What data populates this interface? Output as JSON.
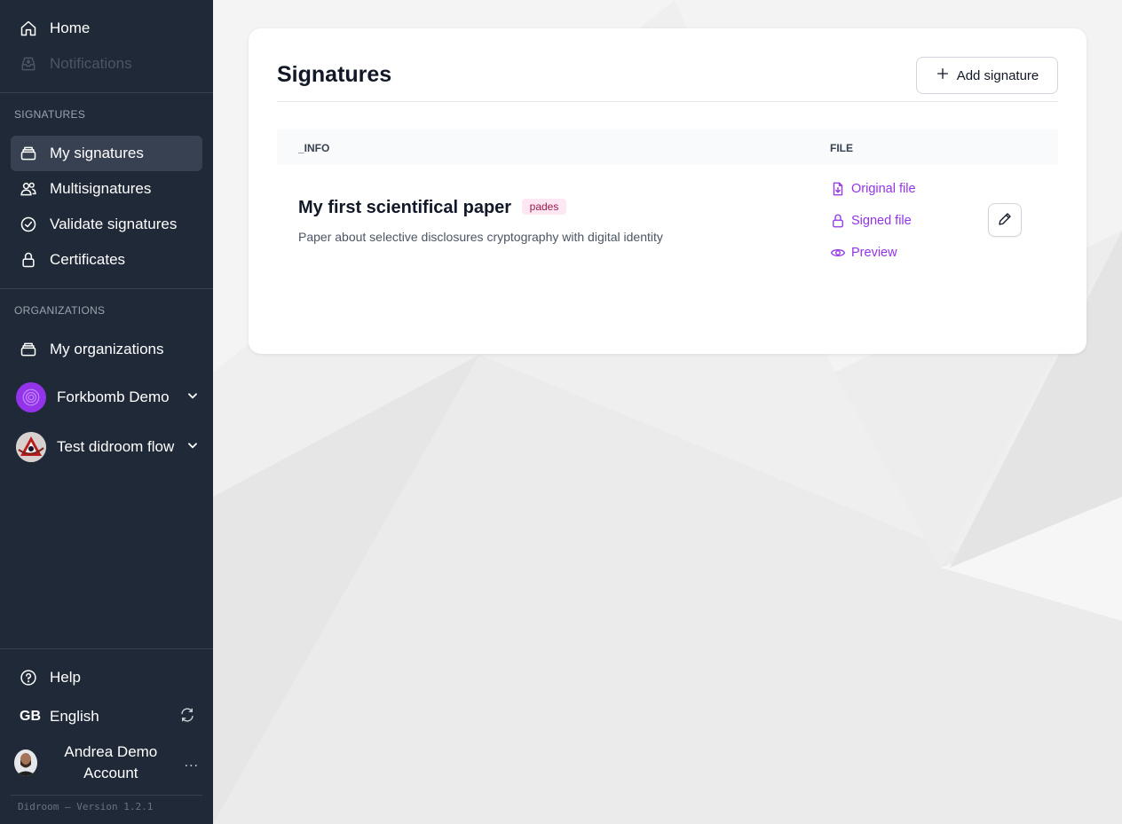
{
  "sidebar": {
    "nav": {
      "home": "Home",
      "notifications": "Notifications"
    },
    "signatures_section": {
      "label": "SIGNATURES",
      "items": [
        "My signatures",
        "Multisignatures",
        "Validate signatures",
        "Certificates"
      ]
    },
    "organizations_section": {
      "label": "ORGANIZATIONS",
      "my_organizations": "My organizations",
      "orgs": [
        "Forkbomb Demo",
        "Test didroom flow"
      ]
    },
    "help": "Help",
    "language": {
      "code": "GB",
      "name": "English"
    },
    "user": {
      "name": "Andrea Demo Account",
      "more": "..."
    },
    "version": "Didroom – Version 1.2.1"
  },
  "main": {
    "title": "Signatures",
    "add_button": "Add signature",
    "table": {
      "headers": [
        "_INFO",
        "FILE"
      ],
      "rows": [
        {
          "title": "My first scientifical paper",
          "tag": "pades",
          "description": "Paper about selective disclosures cryptography with digital identity",
          "links": [
            "Original file",
            "Signed file",
            "Preview"
          ]
        }
      ]
    }
  },
  "colors": {
    "sidebar_bg": "#1f2937",
    "accent": "#9333ea",
    "tag_bg": "#fce7f3",
    "tag_text": "#9d174d"
  },
  "icons": [
    "home-icon",
    "inbox-icon",
    "stack-icon",
    "users-icon",
    "check-circle-icon",
    "lock-icon",
    "chevron-down-icon",
    "help-icon",
    "refresh-icon",
    "plus-icon",
    "file-download-icon",
    "eye-icon",
    "pencil-icon"
  ]
}
